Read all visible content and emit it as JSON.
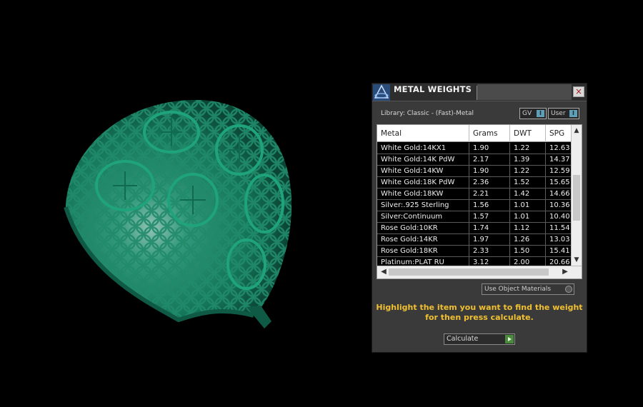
{
  "panel": {
    "title": "METAL WEIGHTS",
    "close_icon": "close-icon",
    "library_label": "Library: Classic - (Fast)-Metal",
    "toggle_gv": {
      "label": "GV",
      "knob": "I"
    },
    "toggle_user": {
      "label": "User",
      "knob": "I"
    },
    "table": {
      "headers": {
        "metal": "Metal",
        "grams": "Grams",
        "dwt": "DWT",
        "spg": "SPG"
      },
      "rows": [
        {
          "metal": "White Gold:14KX1",
          "grams": "1.90",
          "dwt": "1.22",
          "spg": "12.63"
        },
        {
          "metal": "White Gold:14K PdW",
          "grams": "2.17",
          "dwt": "1.39",
          "spg": "14.37"
        },
        {
          "metal": "White Gold:14KW",
          "grams": "1.90",
          "dwt": "1.22",
          "spg": "12.59"
        },
        {
          "metal": "White Gold:18K PdW",
          "grams": "2.36",
          "dwt": "1.52",
          "spg": "15.65"
        },
        {
          "metal": "White Gold:18KW",
          "grams": "2.21",
          "dwt": "1.42",
          "spg": "14.66"
        },
        {
          "metal": "Silver:.925 Sterling",
          "grams": "1.56",
          "dwt": "1.01",
          "spg": "10.36"
        },
        {
          "metal": "Silver:Continuum",
          "grams": "1.57",
          "dwt": "1.01",
          "spg": "10.40"
        },
        {
          "metal": "Rose Gold:10KR",
          "grams": "1.74",
          "dwt": "1.12",
          "spg": "11.54"
        },
        {
          "metal": "Rose Gold:14KR",
          "grams": "1.97",
          "dwt": "1.26",
          "spg": "13.03"
        },
        {
          "metal": "Rose Gold:18KR",
          "grams": "2.33",
          "dwt": "1.50",
          "spg": "15.41"
        },
        {
          "metal": "Platinum:PLAT RU",
          "grams": "3.12",
          "dwt": "2.00",
          "spg": "20.66"
        }
      ]
    },
    "use_object_materials": "Use Object Materials",
    "instructions_line1": "Highlight the item you want to find the weight",
    "instructions_line2": "for then press calculate.",
    "calculate_label": "Calculate"
  },
  "colors": {
    "model_green": "#1a8a6a",
    "instruction_yellow": "#f0c030",
    "toggle_blue": "#5f9fb7",
    "calculate_green": "#4a8a3c"
  }
}
